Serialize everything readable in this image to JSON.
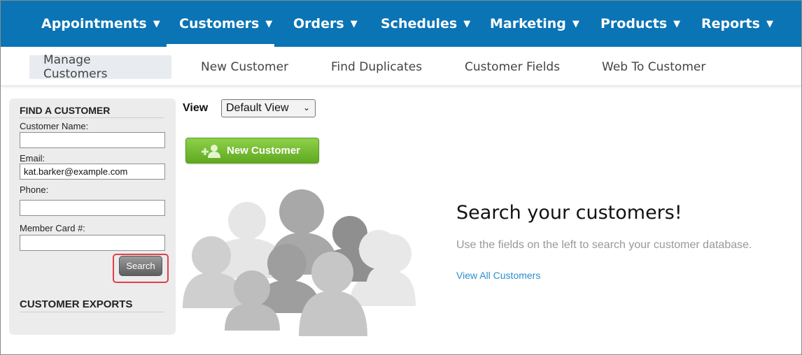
{
  "topnav": [
    {
      "label": "Appointments",
      "caret": "▼"
    },
    {
      "label": "Customers",
      "caret": "▼"
    },
    {
      "label": "Orders",
      "caret": "▼"
    },
    {
      "label": "Schedules",
      "caret": "▼"
    },
    {
      "label": "Marketing",
      "caret": "▼"
    },
    {
      "label": "Products",
      "caret": "▼"
    },
    {
      "label": "Reports",
      "caret": "▼"
    }
  ],
  "active_topnav": "Customers",
  "subnav": [
    "Manage Customers",
    "New Customer",
    "Find Duplicates",
    "Customer Fields",
    "Web To Customer"
  ],
  "active_subnav": "Manage Customers",
  "sidebar": {
    "find_heading": "FIND A CUSTOMER",
    "customer_name_label": "Customer Name:",
    "customer_name_value": "",
    "email_label": "Email:",
    "email_value": "kat.barker@example.com",
    "phone_label": "Phone:",
    "phone_value": "",
    "member_card_label": "Member Card #:",
    "member_card_value": "",
    "search_button": "Search",
    "exports_heading": "CUSTOMER EXPORTS"
  },
  "main": {
    "view_label": "View",
    "view_selected": "Default View",
    "new_customer_button": "New Customer",
    "hero_title": "Search your customers!",
    "hero_desc": "Use the fields on the left to search your customer database.",
    "view_all_link": "View All Customers"
  },
  "colors": {
    "nav_blue": "#0a74b5",
    "green_button": "#6cba2c",
    "link_blue": "#2a8fcc",
    "highlight_red": "#e0404a"
  }
}
